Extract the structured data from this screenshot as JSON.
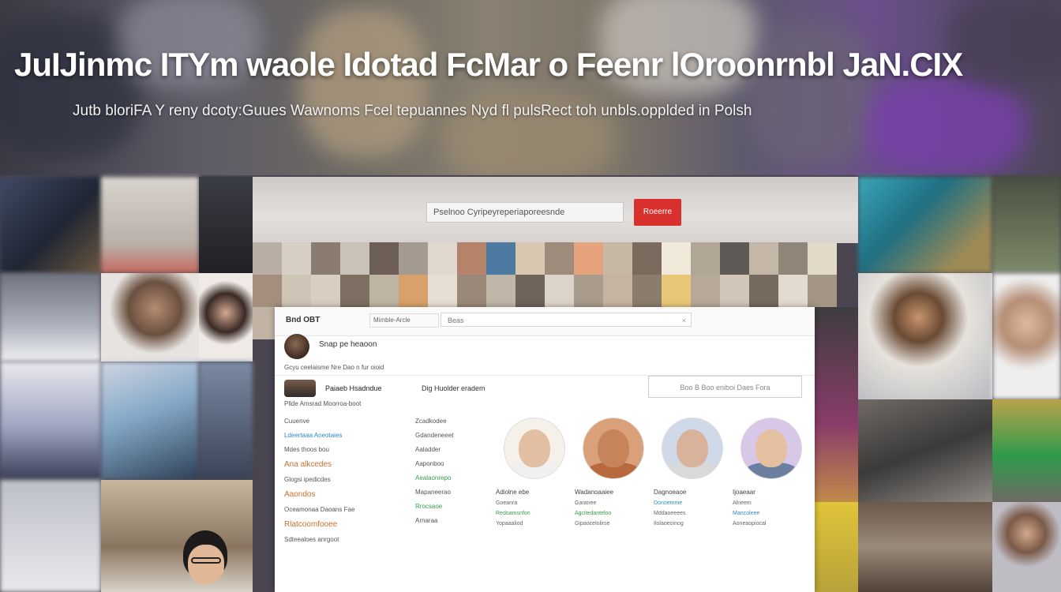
{
  "headline": "JuIJinmc ITYm waole Idotad FcMar o Feenr lOroonrnbl JaN.CIX",
  "subhead": "Jutb bloriFA Y reny dcoty:Guues Wawnoms Fcel tepuannes Nyd fl pulsRect toh unbls.opplded in Polsh",
  "screen": {
    "banner_search": "Pselnoo Cyripeyreperiaporeesnde",
    "banner_button": "Roeerre"
  },
  "app": {
    "brand": "Bnd OBT",
    "brand_search": "Mimble-Arcle",
    "main_search": "Beas",
    "main_search_clear": "×",
    "profile_name": "Snap pe heaoon",
    "profile_meta": "Gcyu ceelaisme Nre Dao n fur oioid",
    "account_name": "Paiaeb Hsadndue",
    "account_sub": "Pllde  Amsrad Moorroa-boot",
    "notify": "Dig Huolder eradem",
    "right_search": "Boo B Boo eniboi Daes Fora",
    "left_items": [
      {
        "text": "Cuuenve",
        "style": ""
      },
      {
        "text": "Ldeertaaa Aoeotaies",
        "style": "blue"
      },
      {
        "text": "Mdes thoos bou",
        "style": ""
      },
      {
        "text": "Ana alkcedes",
        "style": "hl"
      },
      {
        "text": "Glogsi ipedicdes",
        "style": ""
      },
      {
        "text": "Aaondos",
        "style": "hl"
      },
      {
        "text": "Oceamonaa Daoans Fae",
        "style": ""
      },
      {
        "text": "Rlatcoomfooee",
        "style": "hl"
      },
      {
        "text": "Sdteealoes anrgoot",
        "style": ""
      }
    ],
    "mid_items": [
      {
        "text": "Zcadkodee",
        "style": ""
      },
      {
        "text": "Gdandeneeet",
        "style": ""
      },
      {
        "text": "Aaladder",
        "style": ""
      },
      {
        "text": "Aaponboo",
        "style": ""
      },
      {
        "text": "Aealaonrepo",
        "style": "green"
      },
      {
        "text": "Mapaneerao",
        "style": ""
      },
      {
        "text": "Rrocsaoe",
        "style": "green"
      },
      {
        "text": "Arnaraa",
        "style": ""
      }
    ],
    "cards": [
      {
        "name": "Adiolne ebe",
        "lines": [
          "Goeanra",
          "Redoamsnfon",
          "Yopaaaliod"
        ],
        "line_styles": [
          "",
          "green",
          ""
        ],
        "skin": "#e2bfa3",
        "shirt": "#f0f0f0",
        "bg": "#f5f0ea"
      },
      {
        "name": "Wadanoaaiee",
        "lines": [
          "Garanee",
          "Agcitedanteloo",
          "Gipaocelolirse"
        ],
        "line_styles": [
          "",
          "green",
          ""
        ],
        "skin": "#c7845a",
        "shirt": "#b86a3e",
        "bg": "#d9a07a"
      },
      {
        "name": "Dagnoeaoe",
        "lines": [
          "Donoemme",
          "Mddaoeeees",
          "Ilolaoeoinog"
        ],
        "line_styles": [
          "blue",
          "",
          ""
        ],
        "skin": "#d8b29b",
        "shirt": "#d9d9d9",
        "bg": "#cfd9e8"
      },
      {
        "name": "Ijoaeaar",
        "lines": [
          "Alneem",
          "Mancoleee",
          "Aoneaopiocal"
        ],
        "line_styles": [
          "",
          "blue",
          ""
        ],
        "skin": "#e5c0a0",
        "shirt": "#6c7fa0",
        "bg": "#d8c8e8"
      }
    ]
  }
}
